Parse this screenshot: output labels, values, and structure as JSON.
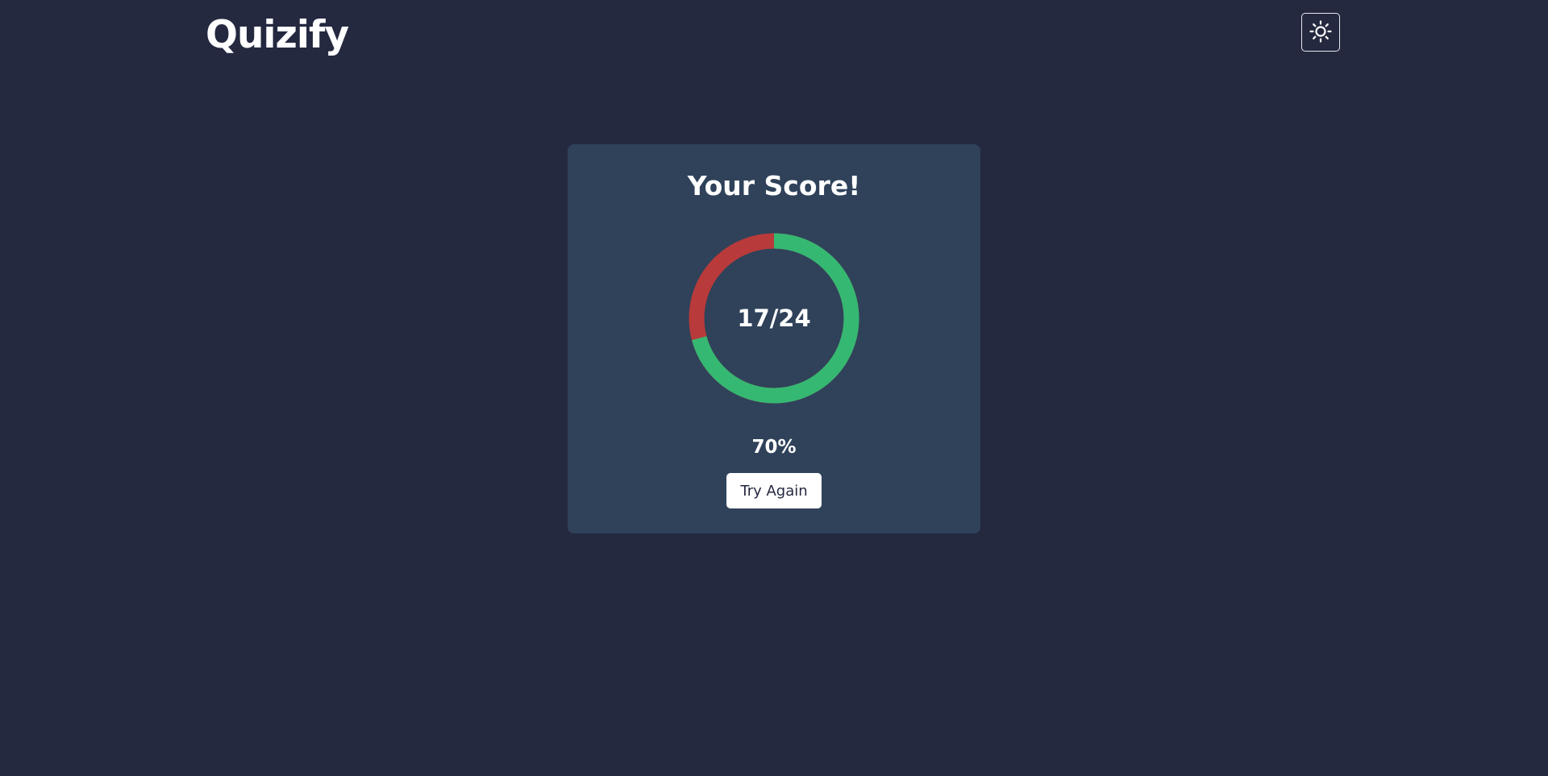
{
  "app": {
    "logo_text": "Quizify"
  },
  "header": {
    "theme_toggle_icon": "sun-icon"
  },
  "result": {
    "title": "Your Score!",
    "correct": 17,
    "total": 24,
    "score_label": "17/24",
    "percent_label": "70%",
    "try_again_label": "Try Again"
  },
  "colors": {
    "background": "#242940",
    "card": "#2f425a",
    "correct": "#35b872",
    "incorrect": "#b83a3a",
    "text": "#ffffff"
  }
}
